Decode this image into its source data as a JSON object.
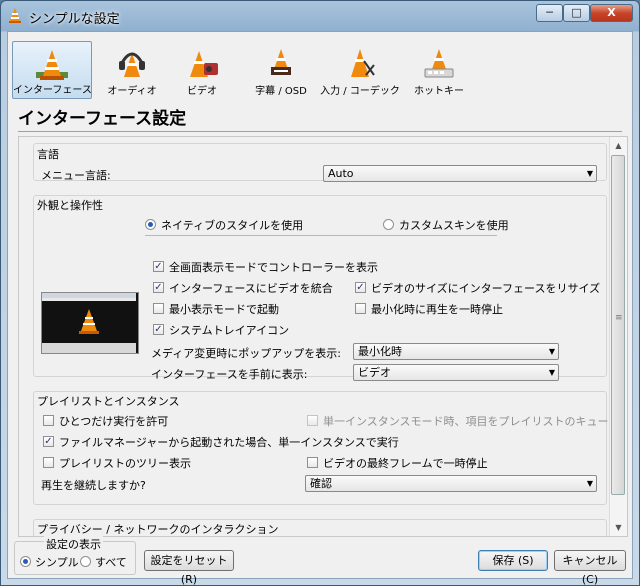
{
  "window": {
    "title": "シンプルな設定",
    "min_label": "─",
    "max_label": "□",
    "close_label": "X"
  },
  "toolbar": {
    "items": [
      {
        "label": "インターフェース",
        "icon": "interface-cone-icon",
        "selected": true
      },
      {
        "label": "オーディオ",
        "icon": "audio-headphones-cone-icon"
      },
      {
        "label": "ビデオ",
        "icon": "video-cone-icon"
      },
      {
        "label": "字幕 / OSD",
        "icon": "subtitle-cone-icon"
      },
      {
        "label": "入力 / コーデック",
        "icon": "codec-cone-icon"
      },
      {
        "label": "ホットキー",
        "icon": "hotkey-cone-icon"
      }
    ]
  },
  "page_title": "インターフェース設定",
  "language": {
    "group_title": "言語",
    "menu_label": "メニュー言語:",
    "menu_value": "Auto"
  },
  "appearance": {
    "group_title": "外観と操作性",
    "native_style": "ネイティブのスタイルを使用",
    "custom_skin": "カスタムスキンを使用",
    "fullscreen_controller": "全画面表示モードでコントローラーを表示",
    "integrate_video": "インターフェースにビデオを統合",
    "resize_interface": "ビデオのサイズにインターフェースをリサイズ",
    "start_minimal": "最小表示モードで起動",
    "pause_minimized": "最小化時に再生を一時停止",
    "systray": "システムトレイアイコン",
    "popup_label": "メディア変更時にポップアップを表示:",
    "popup_value": "最小化時",
    "raise_label": "インターフェースを手前に表示:",
    "raise_value": "ビデオ"
  },
  "playlist": {
    "group_title": "プレイリストとインスタンス",
    "one_instance": "ひとつだけ実行を許可",
    "enqueue": "単一インスタンスモード時、項目をプレイリストのキューに追加",
    "file_manager": "ファイルマネージャーから起動された場合、単一インスタンスで実行",
    "tree": "プレイリストのツリー表示",
    "pause_last_frame": "ビデオの最終フレームで一時停止",
    "resume_label": "再生を継続しますか?",
    "resume_value": "確認"
  },
  "privacy": {
    "group_title": "プライバシー / ネットワークのインタラクション"
  },
  "footer": {
    "show_settings": "設定の表示",
    "simple": "シンプル",
    "all": "すべて",
    "reset": "設定をリセット (R)",
    "save": "保存 (S)",
    "cancel": "キャンセル (C)"
  }
}
